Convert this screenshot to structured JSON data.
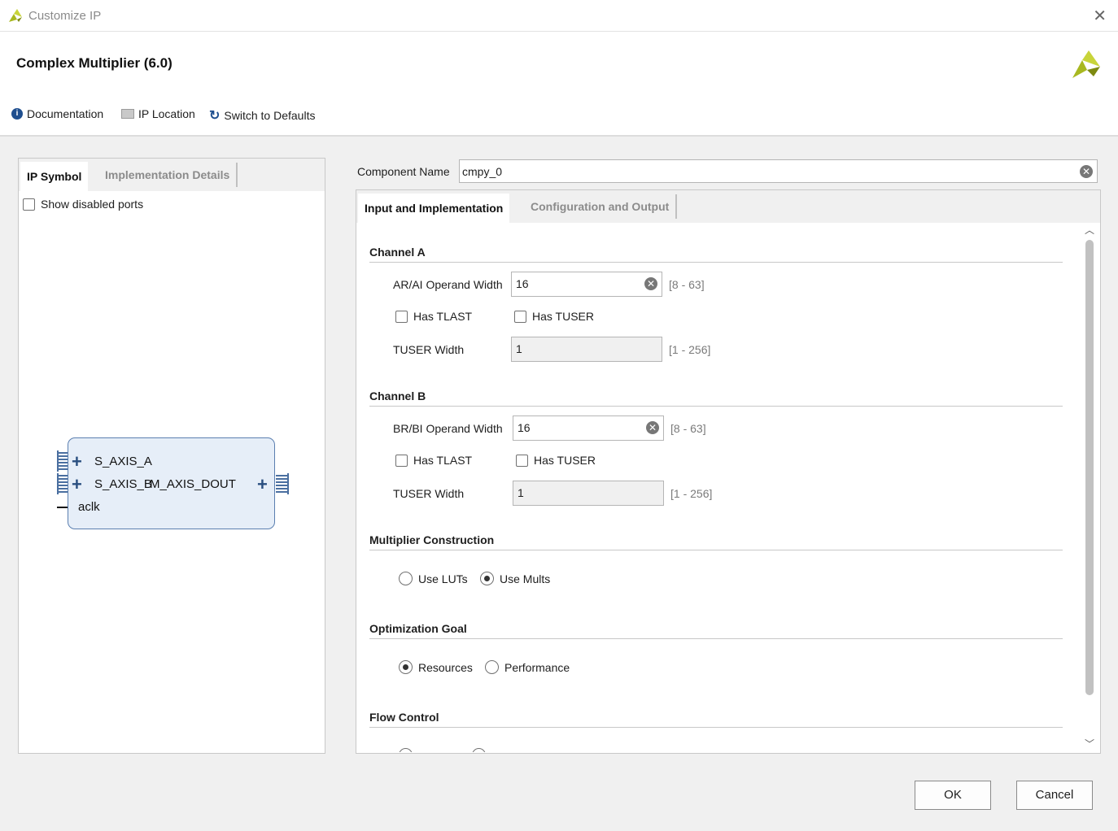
{
  "window": {
    "title": "Customize IP",
    "close": "✕"
  },
  "header": {
    "ip_title": "Complex Multiplier (6.0)"
  },
  "toolbar": {
    "documentation": "Documentation",
    "ip_location": "IP Location",
    "switch_defaults": "Switch to Defaults"
  },
  "left_tabs": {
    "ip_symbol": "IP Symbol",
    "impl_details": "Implementation Details"
  },
  "show_disabled_ports": "Show disabled ports",
  "symbol": {
    "port_a": "S_AXIS_A",
    "port_b": "S_AXIS_B",
    "port_out": "M_AXIS_DOUT",
    "clk": "aclk"
  },
  "component": {
    "label": "Component Name",
    "value": "cmpy_0"
  },
  "right_tabs": {
    "input_impl": "Input and Implementation",
    "config_output": "Configuration and Output"
  },
  "channel_a": {
    "title": "Channel A",
    "width_label": "AR/AI Operand Width",
    "width_value": "16",
    "width_range": "[8 - 63]",
    "tlast": "Has TLAST",
    "tuser": "Has TUSER",
    "tuser_width_label": "TUSER Width",
    "tuser_width_value": "1",
    "tuser_width_range": "[1 - 256]"
  },
  "channel_b": {
    "title": "Channel B",
    "width_label": "BR/BI Operand Width",
    "width_value": "16",
    "width_range": "[8 - 63]",
    "tlast": "Has TLAST",
    "tuser": "Has TUSER",
    "tuser_width_label": "TUSER Width",
    "tuser_width_value": "1",
    "tuser_width_range": "[1 - 256]"
  },
  "mult_construction": {
    "title": "Multiplier Construction",
    "luts": "Use LUTs",
    "mults": "Use Mults",
    "selected": "Use Mults"
  },
  "optimization": {
    "title": "Optimization Goal",
    "resources": "Resources",
    "performance": "Performance",
    "selected": "Resources"
  },
  "flow_control": {
    "title": "Flow Control"
  },
  "buttons": {
    "ok": "OK",
    "cancel": "Cancel"
  },
  "colors": {
    "logo": "#a8b820",
    "bus": "#4a6fa0",
    "block_fill": "#e6eef8"
  }
}
